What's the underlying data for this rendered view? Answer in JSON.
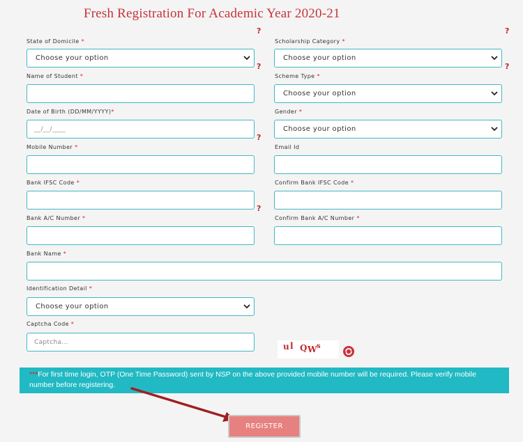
{
  "page": {
    "title": "Fresh Registration For Academic Year 2020-21",
    "help_mark": "?"
  },
  "form": {
    "state_of_domicile": {
      "label": "State of Domicile",
      "required": "*",
      "value": "Choose your option"
    },
    "scholarship_category": {
      "label": "Scholarship Category",
      "required": "*",
      "value": "Choose your option"
    },
    "name_of_student": {
      "label": "Name of Student",
      "required": "*",
      "value": ""
    },
    "scheme_type": {
      "label": "Scheme Type",
      "required": "*",
      "value": "Choose your option"
    },
    "date_of_birth": {
      "label": "Date of Birth (DD/MM/YYYY)",
      "required": "*",
      "placeholder": "__/__/____"
    },
    "gender": {
      "label": "Gender",
      "required": "*",
      "value": "Choose your option"
    },
    "mobile_number": {
      "label": "Mobile Number",
      "required": "*",
      "value": ""
    },
    "email_id": {
      "label": "Email Id",
      "value": ""
    },
    "bank_ifsc_code": {
      "label": "Bank IFSC Code",
      "required": "*",
      "value": ""
    },
    "confirm_bank_ifsc_code": {
      "label": "Confirm Bank IFSC Code",
      "required": "*",
      "value": ""
    },
    "bank_ac_number": {
      "label": "Bank A/C Number",
      "required": "*",
      "value": ""
    },
    "confirm_bank_ac_number": {
      "label": "Confirm Bank A/C Number",
      "required": "*",
      "value": ""
    },
    "bank_name": {
      "label": "Bank Name",
      "required": "*",
      "value": ""
    },
    "identification_detail": {
      "label": "Identification Detail",
      "required": "*",
      "value": "Choose your option"
    },
    "captcha_code": {
      "label": "Captcha Code",
      "required": "*",
      "placeholder": "Captcha..."
    }
  },
  "captcha": {
    "chars": [
      "u",
      "l",
      "Q",
      "W",
      "s"
    ]
  },
  "icons": {
    "chevron": "chevron-down-icon",
    "refresh": "refresh-icon",
    "help": "question-mark-icon"
  },
  "notice": {
    "stars": "***",
    "text": "For first time login, OTP (One Time Password) sent by NSP on the above provided mobile number will be required. Please verify mobile number before registering."
  },
  "register_button": {
    "label": "REGISTER"
  },
  "colors": {
    "title": "#c8323a",
    "field_border": "#40b8c4",
    "notice_bg": "#21b9c3",
    "register_bg": "#e7817f",
    "required": "#d2232a",
    "arrow": "#a01f22"
  }
}
